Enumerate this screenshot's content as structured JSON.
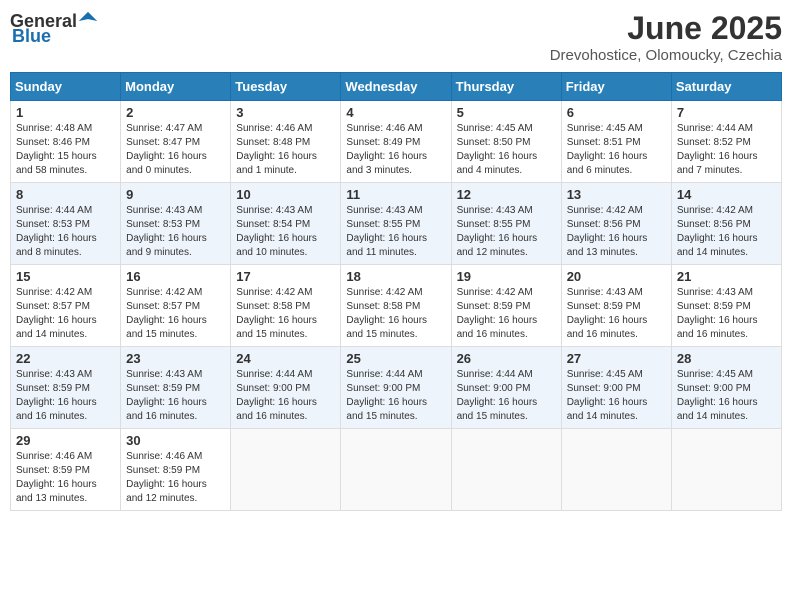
{
  "header": {
    "logo_general": "General",
    "logo_blue": "Blue",
    "month": "June 2025",
    "location": "Drevohostice, Olomoucky, Czechia"
  },
  "days_of_week": [
    "Sunday",
    "Monday",
    "Tuesday",
    "Wednesday",
    "Thursday",
    "Friday",
    "Saturday"
  ],
  "weeks": [
    [
      {
        "day": "1",
        "sunrise": "Sunrise: 4:48 AM",
        "sunset": "Sunset: 8:46 PM",
        "daylight": "Daylight: 15 hours and 58 minutes."
      },
      {
        "day": "2",
        "sunrise": "Sunrise: 4:47 AM",
        "sunset": "Sunset: 8:47 PM",
        "daylight": "Daylight: 16 hours and 0 minutes."
      },
      {
        "day": "3",
        "sunrise": "Sunrise: 4:46 AM",
        "sunset": "Sunset: 8:48 PM",
        "daylight": "Daylight: 16 hours and 1 minute."
      },
      {
        "day": "4",
        "sunrise": "Sunrise: 4:46 AM",
        "sunset": "Sunset: 8:49 PM",
        "daylight": "Daylight: 16 hours and 3 minutes."
      },
      {
        "day": "5",
        "sunrise": "Sunrise: 4:45 AM",
        "sunset": "Sunset: 8:50 PM",
        "daylight": "Daylight: 16 hours and 4 minutes."
      },
      {
        "day": "6",
        "sunrise": "Sunrise: 4:45 AM",
        "sunset": "Sunset: 8:51 PM",
        "daylight": "Daylight: 16 hours and 6 minutes."
      },
      {
        "day": "7",
        "sunrise": "Sunrise: 4:44 AM",
        "sunset": "Sunset: 8:52 PM",
        "daylight": "Daylight: 16 hours and 7 minutes."
      }
    ],
    [
      {
        "day": "8",
        "sunrise": "Sunrise: 4:44 AM",
        "sunset": "Sunset: 8:53 PM",
        "daylight": "Daylight: 16 hours and 8 minutes."
      },
      {
        "day": "9",
        "sunrise": "Sunrise: 4:43 AM",
        "sunset": "Sunset: 8:53 PM",
        "daylight": "Daylight: 16 hours and 9 minutes."
      },
      {
        "day": "10",
        "sunrise": "Sunrise: 4:43 AM",
        "sunset": "Sunset: 8:54 PM",
        "daylight": "Daylight: 16 hours and 10 minutes."
      },
      {
        "day": "11",
        "sunrise": "Sunrise: 4:43 AM",
        "sunset": "Sunset: 8:55 PM",
        "daylight": "Daylight: 16 hours and 11 minutes."
      },
      {
        "day": "12",
        "sunrise": "Sunrise: 4:43 AM",
        "sunset": "Sunset: 8:55 PM",
        "daylight": "Daylight: 16 hours and 12 minutes."
      },
      {
        "day": "13",
        "sunrise": "Sunrise: 4:42 AM",
        "sunset": "Sunset: 8:56 PM",
        "daylight": "Daylight: 16 hours and 13 minutes."
      },
      {
        "day": "14",
        "sunrise": "Sunrise: 4:42 AM",
        "sunset": "Sunset: 8:56 PM",
        "daylight": "Daylight: 16 hours and 14 minutes."
      }
    ],
    [
      {
        "day": "15",
        "sunrise": "Sunrise: 4:42 AM",
        "sunset": "Sunset: 8:57 PM",
        "daylight": "Daylight: 16 hours and 14 minutes."
      },
      {
        "day": "16",
        "sunrise": "Sunrise: 4:42 AM",
        "sunset": "Sunset: 8:57 PM",
        "daylight": "Daylight: 16 hours and 15 minutes."
      },
      {
        "day": "17",
        "sunrise": "Sunrise: 4:42 AM",
        "sunset": "Sunset: 8:58 PM",
        "daylight": "Daylight: 16 hours and 15 minutes."
      },
      {
        "day": "18",
        "sunrise": "Sunrise: 4:42 AM",
        "sunset": "Sunset: 8:58 PM",
        "daylight": "Daylight: 16 hours and 15 minutes."
      },
      {
        "day": "19",
        "sunrise": "Sunrise: 4:42 AM",
        "sunset": "Sunset: 8:59 PM",
        "daylight": "Daylight: 16 hours and 16 minutes."
      },
      {
        "day": "20",
        "sunrise": "Sunrise: 4:43 AM",
        "sunset": "Sunset: 8:59 PM",
        "daylight": "Daylight: 16 hours and 16 minutes."
      },
      {
        "day": "21",
        "sunrise": "Sunrise: 4:43 AM",
        "sunset": "Sunset: 8:59 PM",
        "daylight": "Daylight: 16 hours and 16 minutes."
      }
    ],
    [
      {
        "day": "22",
        "sunrise": "Sunrise: 4:43 AM",
        "sunset": "Sunset: 8:59 PM",
        "daylight": "Daylight: 16 hours and 16 minutes."
      },
      {
        "day": "23",
        "sunrise": "Sunrise: 4:43 AM",
        "sunset": "Sunset: 8:59 PM",
        "daylight": "Daylight: 16 hours and 16 minutes."
      },
      {
        "day": "24",
        "sunrise": "Sunrise: 4:44 AM",
        "sunset": "Sunset: 9:00 PM",
        "daylight": "Daylight: 16 hours and 16 minutes."
      },
      {
        "day": "25",
        "sunrise": "Sunrise: 4:44 AM",
        "sunset": "Sunset: 9:00 PM",
        "daylight": "Daylight: 16 hours and 15 minutes."
      },
      {
        "day": "26",
        "sunrise": "Sunrise: 4:44 AM",
        "sunset": "Sunset: 9:00 PM",
        "daylight": "Daylight: 16 hours and 15 minutes."
      },
      {
        "day": "27",
        "sunrise": "Sunrise: 4:45 AM",
        "sunset": "Sunset: 9:00 PM",
        "daylight": "Daylight: 16 hours and 14 minutes."
      },
      {
        "day": "28",
        "sunrise": "Sunrise: 4:45 AM",
        "sunset": "Sunset: 9:00 PM",
        "daylight": "Daylight: 16 hours and 14 minutes."
      }
    ],
    [
      {
        "day": "29",
        "sunrise": "Sunrise: 4:46 AM",
        "sunset": "Sunset: 8:59 PM",
        "daylight": "Daylight: 16 hours and 13 minutes."
      },
      {
        "day": "30",
        "sunrise": "Sunrise: 4:46 AM",
        "sunset": "Sunset: 8:59 PM",
        "daylight": "Daylight: 16 hours and 12 minutes."
      },
      null,
      null,
      null,
      null,
      null
    ]
  ]
}
